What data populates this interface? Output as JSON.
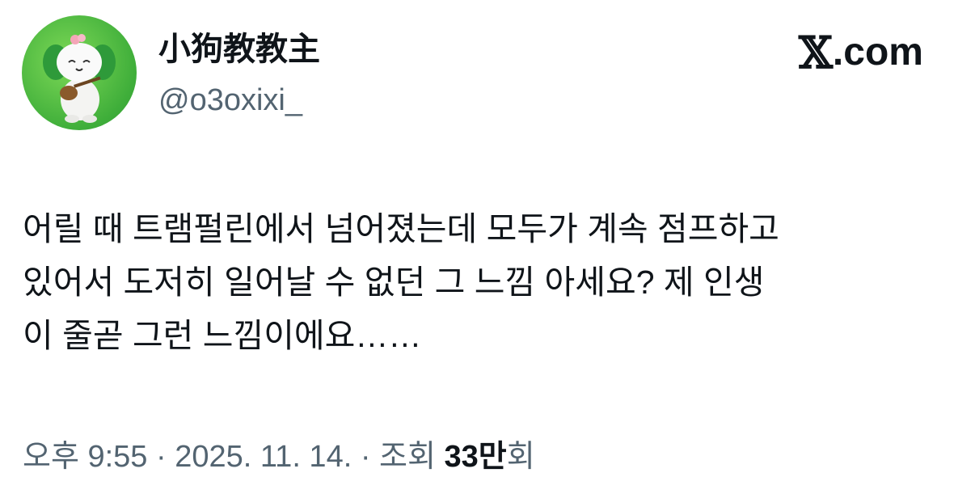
{
  "author": {
    "display_name": "小狗教教主",
    "handle": "@o3oxixi_"
  },
  "brand": {
    "logo_glyph": "𝕏",
    "domain_label": ".com"
  },
  "tweet": {
    "lines": [
      "어릴 때 트램펄린에서 넘어졌는데 모두가 계속 점프하고",
      "있어서 도저히 일어날 수 없던 그 느낌 아세요? 제 인생",
      "이 줄곧 그런 느낌이에요……"
    ]
  },
  "meta": {
    "time": "오후 9:55",
    "separator": " · ",
    "date": "2025. 11. 14.",
    "views_label": "조회 ",
    "views_count": "33만",
    "views_suffix": "회"
  },
  "colors": {
    "text_primary": "#0f1419",
    "text_secondary": "#536471",
    "avatar_bg": "#3fae3a"
  },
  "icons": {
    "avatar": "mascot-avatar-icon",
    "logo": "x-logo-icon"
  }
}
